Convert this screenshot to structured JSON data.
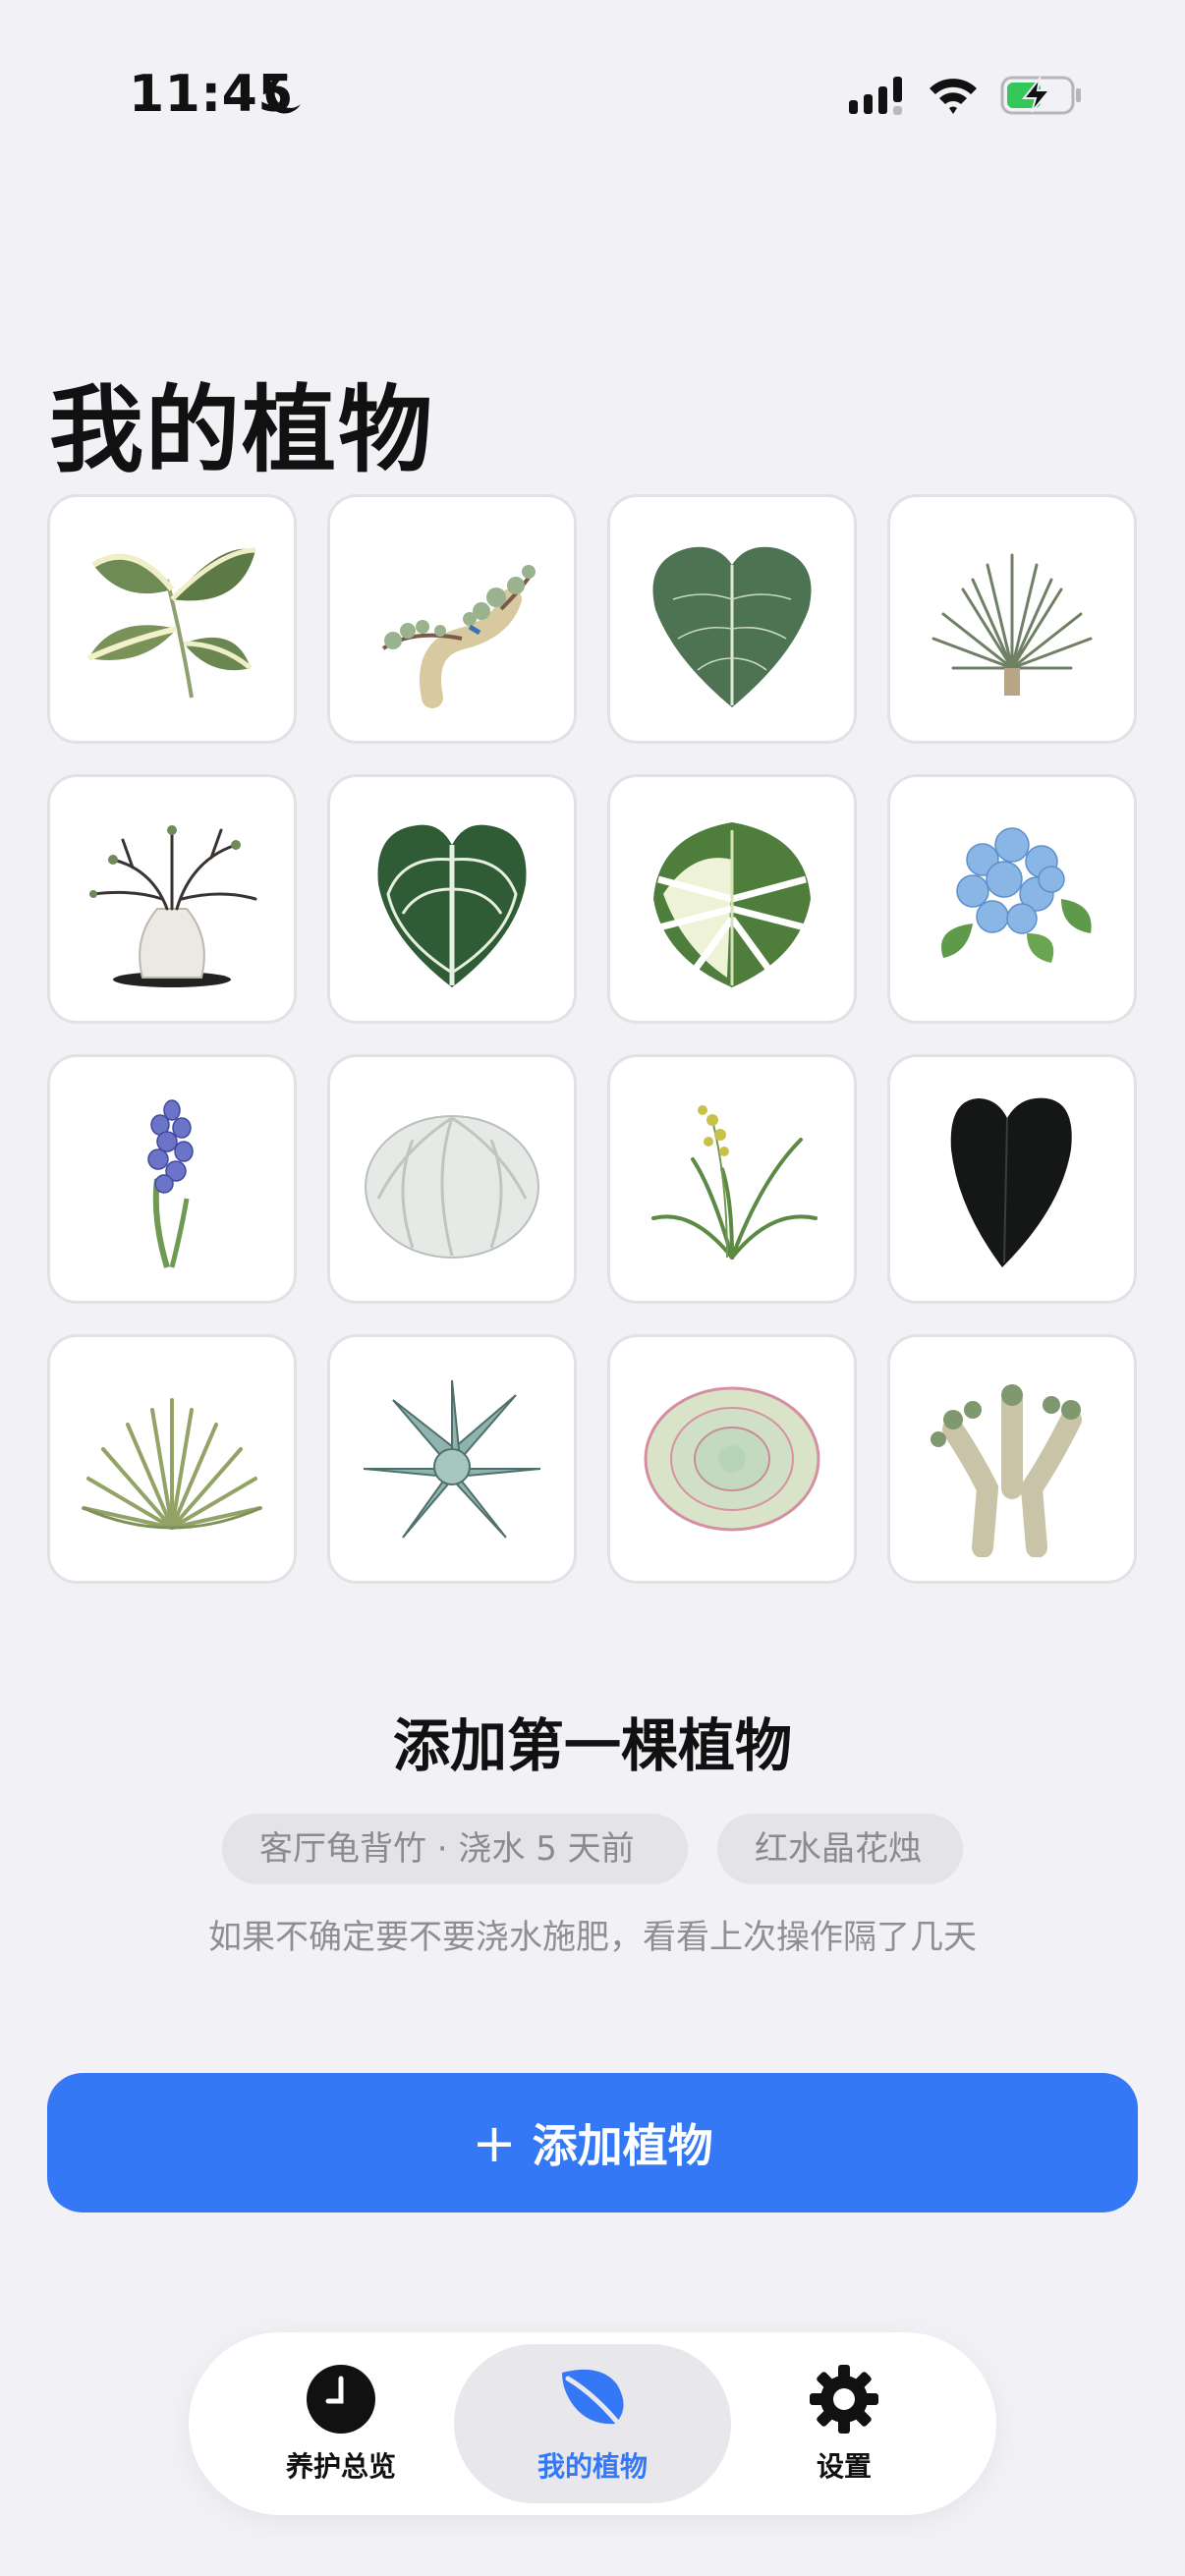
{
  "status_bar": {
    "time": "11:45"
  },
  "page_title": "我的植物",
  "plants": [
    "pothos",
    "bonsai",
    "philodendron",
    "yucca",
    "caudex-bonsai",
    "anthurium-crystallinum",
    "variegated-monstera",
    "hydrangea",
    "hyacinth",
    "astrophytum",
    "orchid",
    "black-anthurium",
    "fan-palm",
    "agave",
    "echeveria",
    "euphorbia"
  ],
  "empty_state": {
    "title": "添加第一棵植物",
    "chips": [
      "客厅龟背竹 · 浇水 5 天前",
      "红水晶花烛"
    ],
    "hint": "如果不确定要不要浇水施肥，看看上次操作隔了几天"
  },
  "add_button": {
    "icon": "+",
    "label": "添加植物"
  },
  "tabs": [
    {
      "label": "养护总览",
      "icon": "clock-icon"
    },
    {
      "label": "我的植物",
      "icon": "leaf-icon",
      "selected": true
    },
    {
      "label": "设置",
      "icon": "gear-icon"
    }
  ],
  "colors": {
    "accent": "#3478F6",
    "background": "#F1F1F6",
    "battery": "#34C759"
  }
}
